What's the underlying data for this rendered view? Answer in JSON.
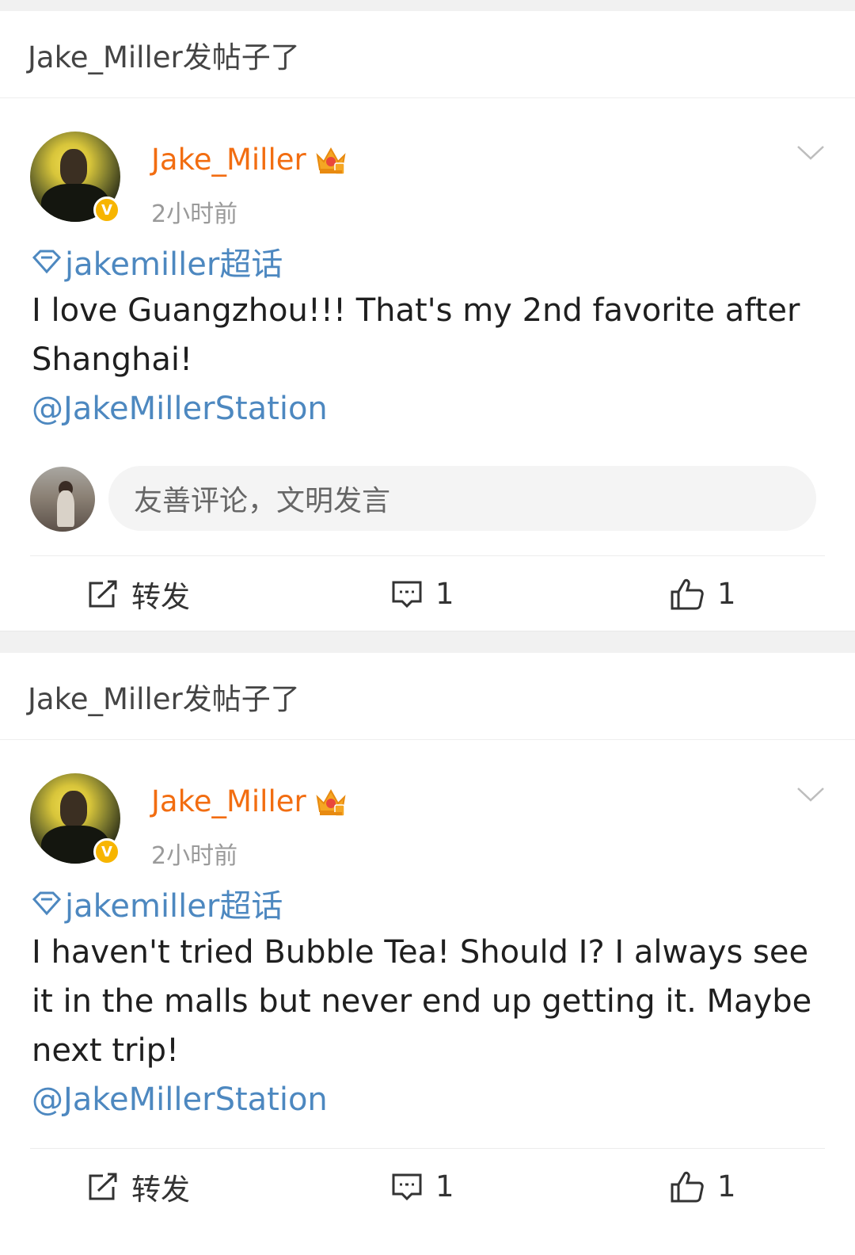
{
  "colors": {
    "author": "#f26d11",
    "link": "#4d88c0",
    "muted": "#9a9a9a",
    "badge": "#f7b500"
  },
  "comment_box": {
    "placeholder": "友善评论，文明发言"
  },
  "posts": [
    {
      "header": "Jake_Miller发帖子了",
      "author": "Jake_Miller",
      "badge_letter": "V",
      "time": "2小时前",
      "topic": "jakemiller超话",
      "text": "I love Guangzhou!!! That's my 2nd favorite after Shanghai!",
      "mention": "@JakeMillerStation",
      "repost_label": "转发",
      "comment_count": "1",
      "like_count": "1"
    },
    {
      "header": "Jake_Miller发帖子了",
      "author": "Jake_Miller",
      "badge_letter": "V",
      "time": "2小时前",
      "topic": "jakemiller超话",
      "text": "I haven't tried Bubble Tea! Should I? I always see it in the malls but never end up getting it. Maybe next trip!",
      "mention": "@JakeMillerStation",
      "repost_label": "转发",
      "comment_count": "1",
      "like_count": "1"
    }
  ]
}
